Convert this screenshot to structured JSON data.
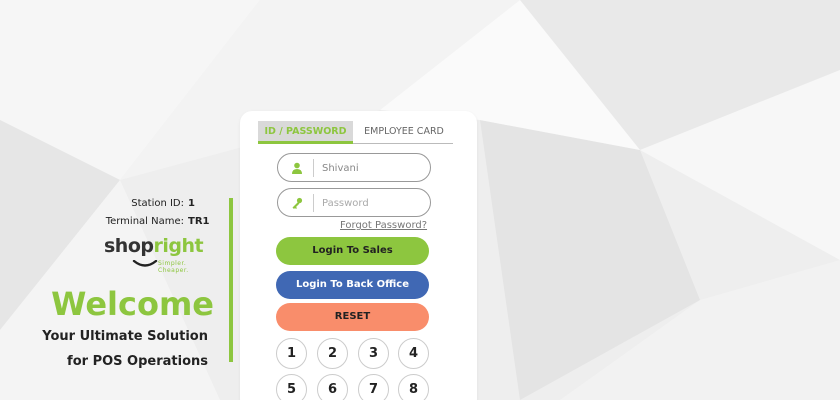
{
  "station": {
    "label": "Station ID:",
    "value": "1"
  },
  "terminal": {
    "label": "Terminal Name:",
    "value": "TR1"
  },
  "brand": {
    "word_dark": "shop",
    "word_green": "right",
    "tagline": "Simpler. Cheaper."
  },
  "welcome": {
    "title": "Welcome",
    "line1": "Your Ultimate Solution",
    "line2": "for POS Operations"
  },
  "tabs": [
    {
      "label": "ID / PASSWORD",
      "active": true
    },
    {
      "label": "EMPLOYEE CARD",
      "active": false
    }
  ],
  "login": {
    "username_value": "Shivani",
    "password_placeholder": "Password",
    "forgot_label": "Forgot Password?"
  },
  "buttons": {
    "sales": "Login To Sales",
    "back_office": "Login To Back Office",
    "reset": "RESET"
  },
  "keypad": [
    "1",
    "2",
    "3",
    "4",
    "5",
    "6",
    "7",
    "8"
  ],
  "colors": {
    "accent": "#8dc63f",
    "blue": "#4068b4",
    "reset": "#f98d6b"
  }
}
